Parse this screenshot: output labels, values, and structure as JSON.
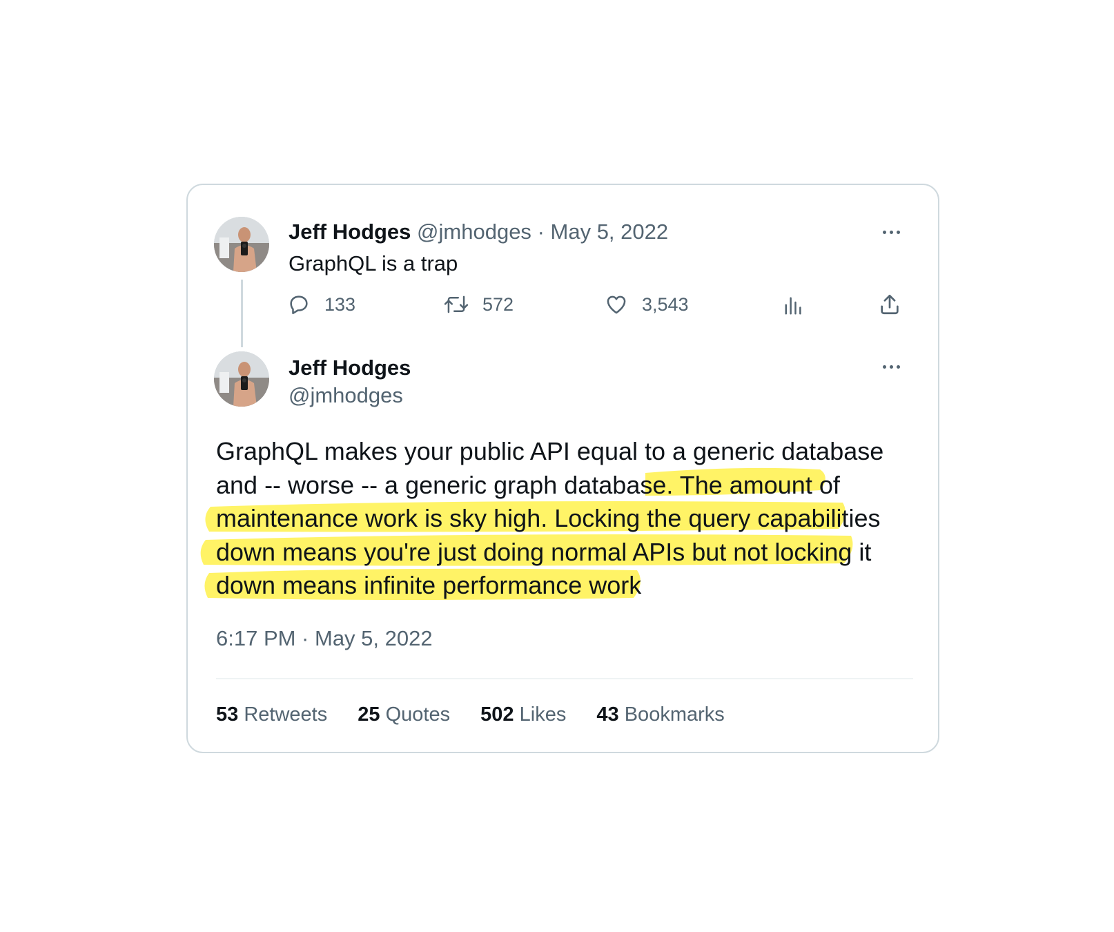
{
  "parent_tweet": {
    "author_name": "Jeff Hodges",
    "author_handle": "@jmhodges",
    "separator": "·",
    "date": "May 5, 2022",
    "text": "GraphQL is a trap",
    "replies": "133",
    "retweets": "572",
    "likes": "3,543"
  },
  "main_tweet": {
    "author_name": "Jeff Hodges",
    "author_handle": "@jmhodges",
    "text_lines": [
      "GraphQL makes your public API equal to a generic database",
      "and -- worse -- a generic graph database. The amount of",
      "maintenance work is sky high. Locking the query capabilities",
      "down means you're just doing normal APIs but not locking it",
      "down means infinite performance work"
    ],
    "timestamp": "6:17 PM · May 5, 2022",
    "stats": {
      "retweets_count": "53",
      "retweets_label": "Retweets",
      "quotes_count": "25",
      "quotes_label": "Quotes",
      "likes_count": "502",
      "likes_label": "Likes",
      "bookmarks_count": "43",
      "bookmarks_label": "Bookmarks"
    }
  },
  "colors": {
    "highlight": "#fff35a",
    "muted_text": "#536471",
    "border": "#cfd9de"
  },
  "icons": [
    "avatar-photo",
    "more-icon",
    "reply-icon",
    "retweet-icon",
    "like-icon",
    "views-icon",
    "share-icon"
  ]
}
